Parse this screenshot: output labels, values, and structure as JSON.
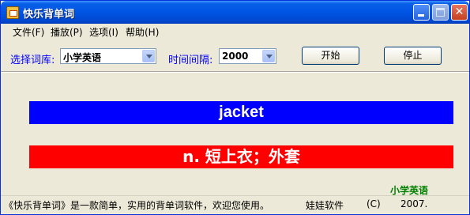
{
  "window": {
    "title": "快乐背单词",
    "min_icon": "minimize-icon",
    "max_icon": "maximize-icon",
    "close_glyph": "✕"
  },
  "menu": {
    "items": [
      {
        "label": "文件(F)"
      },
      {
        "label": "播放(P)"
      },
      {
        "label": "选项(I)"
      },
      {
        "label": "帮助(H)"
      }
    ]
  },
  "toolbar": {
    "lib_label": "选择词库:",
    "lib_value": "小学英语",
    "interval_label": "时间间隔:",
    "interval_value": "2000",
    "start_button": "开始",
    "stop_button": "停止"
  },
  "display": {
    "word": "jacket",
    "meaning": "n. 短上衣；外套",
    "current_library": "小学英语",
    "colors": {
      "word_bg": "#0000ff",
      "meaning_bg": "#ff0000",
      "library_text": "#008000"
    }
  },
  "status": {
    "description": "《快乐背单词》是一款简单，实用的背单词软件，欢迎您使用。",
    "author": "娃娃软件",
    "copyright": "(C)",
    "year": "2007."
  }
}
